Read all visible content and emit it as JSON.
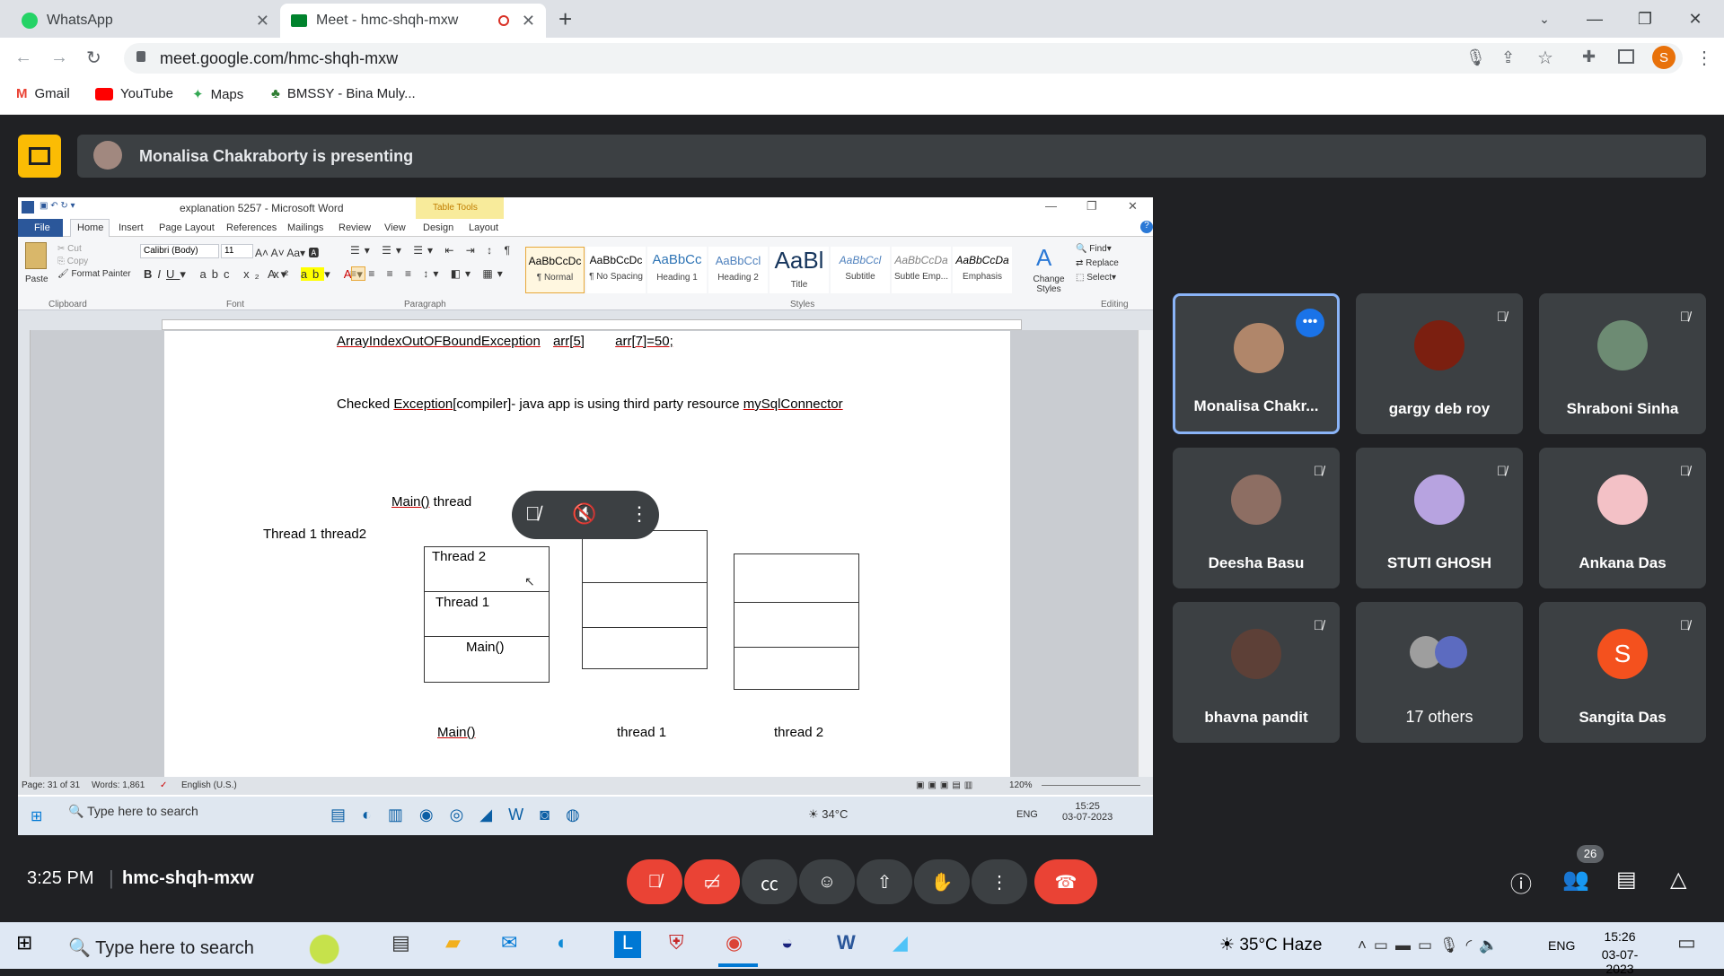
{
  "browser": {
    "tabs": [
      {
        "title": "WhatsApp"
      },
      {
        "title": "Meet - hmc-shqh-mxw"
      }
    ],
    "url": "meet.google.com/hmc-shqh-mxw",
    "profile_initial": "S",
    "bookmarks": [
      "Gmail",
      "YouTube",
      "Maps",
      "BMSSY - Bina Muly..."
    ]
  },
  "meet": {
    "presenting_text": "Monalisa Chakraborty is presenting",
    "time": "3:25 PM",
    "meeting_code": "hmc-shqh-mxw",
    "participant_count": "26",
    "participants": [
      {
        "name": "Monalisa Chakr...",
        "muted": false
      },
      {
        "name": "gargy deb roy",
        "muted": true
      },
      {
        "name": "Shraboni Sinha",
        "muted": true
      },
      {
        "name": "Deesha Basu",
        "muted": true
      },
      {
        "name": "STUTI GHOSH",
        "muted": true
      },
      {
        "name": "Ankana Das",
        "muted": true
      },
      {
        "name": "bhavna pandit",
        "muted": true
      },
      {
        "name": "17 others",
        "muted": false
      },
      {
        "name": "Sangita Das",
        "muted": true,
        "initial": "S"
      }
    ]
  },
  "word": {
    "title": "explanation 5257 - Microsoft Word",
    "context_tab": "Table Tools",
    "tabs": [
      "File",
      "Home",
      "Insert",
      "Page Layout",
      "References",
      "Mailings",
      "Review",
      "View",
      "Design",
      "Layout"
    ],
    "font": "Calibri (Body)",
    "size": "11",
    "clipboard": {
      "paste": "Paste",
      "cut": "Cut",
      "copy": "Copy",
      "format_painter": "Format Painter",
      "group": "Clipboard"
    },
    "groups": {
      "font": "Font",
      "paragraph": "Paragraph",
      "styles": "Styles",
      "editing": "Editing"
    },
    "styles": [
      {
        "sample": "AaBbCcDc",
        "label": "¶ Normal"
      },
      {
        "sample": "AaBbCcDc",
        "label": "¶ No Spacing"
      },
      {
        "sample": "AaBbCc",
        "label": "Heading 1"
      },
      {
        "sample": "AaBbCcl",
        "label": "Heading 2"
      },
      {
        "sample": "AaBl",
        "label": "Title"
      },
      {
        "sample": "AaBbCcl",
        "label": "Subtitle"
      },
      {
        "sample": "AaBbCcDa",
        "label": "Subtle Emp..."
      },
      {
        "sample": "AaBbCcDa",
        "label": "Emphasis"
      }
    ],
    "change_styles": "Change Styles",
    "editing": {
      "find": "Find",
      "replace": "Replace",
      "select": "Select"
    },
    "doc": {
      "line1_a": "ArrayIndexOutOFBoundException",
      "line1_b": "arr[5]",
      "line1_c": "arr[7]=50;",
      "line2_a": "Checked ",
      "line2_b": "Exception",
      "line2_c": "[compiler]- java app is using third party resource ",
      "line2_d": "mySqlConnector",
      "main_thread": "Main() thread",
      "main_thread_u": "Main()",
      "main_thread_rest": " thread",
      "threads_line": "Thread 1 thread2",
      "stack_thread2": "Thread 2",
      "stack_thread1": "Thread 1",
      "stack_main": "Main()",
      "label_main": "Main()",
      "label_t1": "thread 1",
      "label_t2": "thread 2"
    },
    "status": {
      "page": "Page: 31 of 31",
      "words": "Words: 1,861",
      "lang": "English (U.S.)",
      "zoom": "120%"
    },
    "inner_taskbar": {
      "search": "Type here to search",
      "temp": "34°C",
      "lang": "ENG",
      "time": "15:25",
      "date": "03-07-2023"
    }
  },
  "taskbar": {
    "search": "Type here to search",
    "weather": "35°C  Haze",
    "lang": "ENG",
    "time": "15:26",
    "date": "03-07-2023"
  }
}
